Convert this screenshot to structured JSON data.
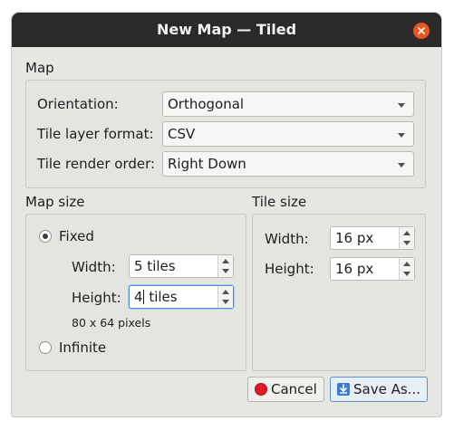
{
  "window": {
    "title": "New Map — Tiled"
  },
  "map": {
    "section_label": "Map",
    "orientation": {
      "label": "Orientation:",
      "value": "Orthogonal"
    },
    "layer_format": {
      "label": "Tile layer format:",
      "value": "CSV"
    },
    "render_order": {
      "label": "Tile render order:",
      "value": "Right Down"
    }
  },
  "map_size": {
    "section_label": "Map size",
    "fixed_label": "Fixed",
    "width": {
      "label": "Width:",
      "value": "5 tiles"
    },
    "height": {
      "label": "Height:",
      "value_before_caret": "4",
      "value_after_caret": " tiles"
    },
    "pixel_info": "80 x 64 pixels",
    "infinite_label": "Infinite",
    "selected": "Fixed"
  },
  "tile_size": {
    "section_label": "Tile size",
    "width": {
      "label": "Width:",
      "value": "16 px"
    },
    "height": {
      "label": "Height:",
      "value": "16 px"
    }
  },
  "buttons": {
    "cancel_label": "Cancel",
    "save_label": "Save As..."
  },
  "icons": {
    "close": "close-icon",
    "cancel": "record-stop-icon",
    "save": "save-download-icon"
  },
  "colors": {
    "accent_close": "#e95420",
    "focus": "#4a90d9"
  }
}
